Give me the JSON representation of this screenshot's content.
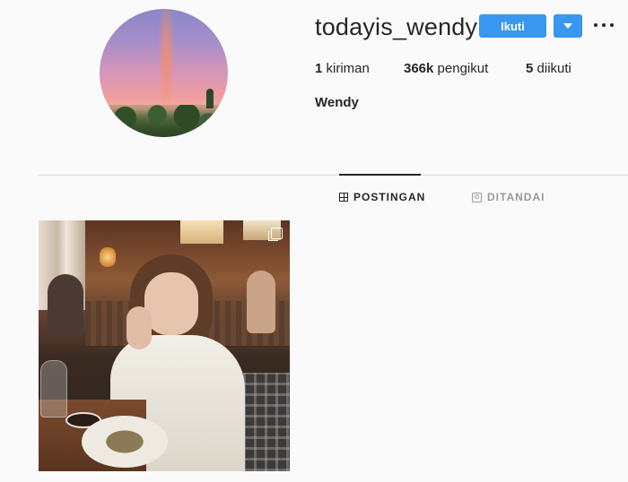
{
  "profile": {
    "username": "todayis_wendy",
    "full_name": "Wendy",
    "avatar_alt": "profile-picture-sunset-rainbow"
  },
  "actions": {
    "follow_label": "Ikuti",
    "dropdown_icon": "chevron-down-icon",
    "more_icon": "more-options-icon"
  },
  "stats": [
    {
      "count": "1",
      "label": "kiriman"
    },
    {
      "count": "366k",
      "label": "pengikut"
    },
    {
      "count": "5",
      "label": "diikuti"
    }
  ],
  "tabs": [
    {
      "label": "POSTINGAN",
      "icon": "grid-icon",
      "active": true
    },
    {
      "label": "DITANDAI",
      "icon": "tag-icon",
      "active": false
    }
  ],
  "posts": [
    {
      "description": "photo-woman-restaurant",
      "type": "carousel",
      "indicator_icon": "multiple-photos-icon"
    }
  ],
  "colors": {
    "accent": "#3897f0",
    "text": "#262626",
    "muted": "#999999",
    "divider": "#dbdbdb",
    "background": "#fafafa"
  }
}
